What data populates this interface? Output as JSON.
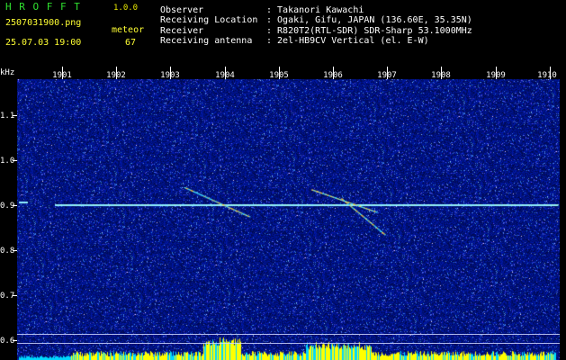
{
  "header": {
    "app_title": "H R O F F T",
    "version": "1.0.0",
    "filename": "2507031900.png",
    "datetime": "25.07.03 19:00",
    "detect_label": "meteor",
    "detect_count": "67",
    "fields": [
      {
        "label": "Observer",
        "value": ": Takanori Kawachi"
      },
      {
        "label": "Receiving Location",
        "value": ": Ogaki, Gifu, JAPAN (136.60E, 35.35N)"
      },
      {
        "label": "Receiver",
        "value": ": R820T2(RTL-SDR) SDR-Sharp 53.1000MHz"
      },
      {
        "label": "Receiving antenna",
        "value": ": 2el-HB9CV Vertical (el. E-W)"
      }
    ]
  },
  "axes": {
    "y_unit": "kHz",
    "y_ticks": [
      "1.1",
      "1.0",
      "0.9",
      "0.8",
      "0.7",
      "0.6"
    ],
    "x_ticks": [
      "1901",
      "1902",
      "1903",
      "1904",
      "1905",
      "1906",
      "1907",
      "1908",
      "1909",
      "1910"
    ]
  },
  "colors": {
    "background": "#000000",
    "noise_dark": "#000a60",
    "noise_mid": "#1a2fb8",
    "carrier": "#8ff0ff",
    "meteor_trail": "#ffd040",
    "bottom_bars": "#ffff00",
    "bottom_bars_alt": "#00d8ff"
  },
  "spectrogram": {
    "carrier_khz": 0.9,
    "carrier_start_minute": 1901,
    "meteor_traces": [
      {
        "t_start": 1903.25,
        "f_start": 0.94,
        "t_end": 1904.45,
        "f_end": 0.875
      },
      {
        "t_start": 1905.6,
        "f_start": 0.935,
        "t_end": 1906.8,
        "f_end": 0.885
      },
      {
        "t_start": 1906.15,
        "f_start": 0.915,
        "t_end": 1906.95,
        "f_end": 0.835
      }
    ]
  }
}
